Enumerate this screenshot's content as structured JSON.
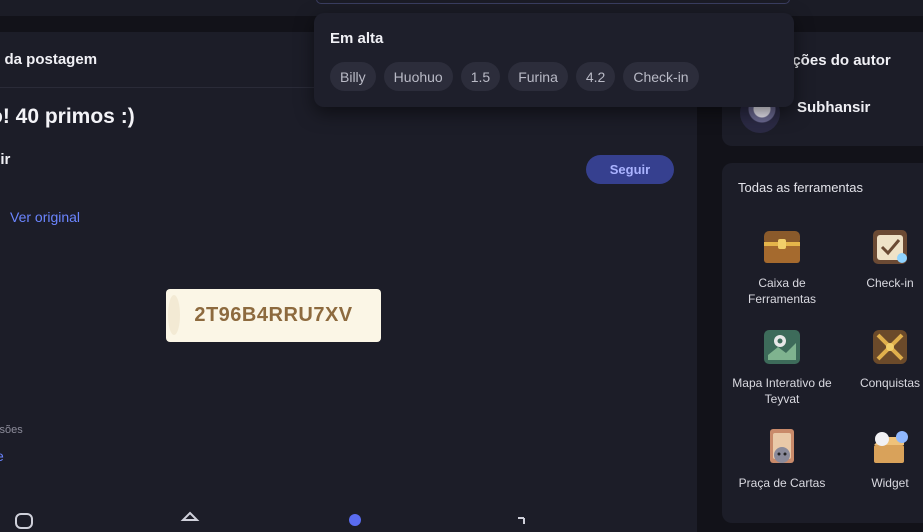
{
  "trending": {
    "title": "Em alta",
    "chips": [
      "Billy",
      "Huohuo",
      "1.5",
      "Furina",
      "4.2",
      "Check-in"
    ]
  },
  "post": {
    "header_title": "s da postagem",
    "title": "o! 40 primos :)",
    "author": "sir",
    "follow_label": "Seguir",
    "view_original": "Ver original",
    "code": "2T96B4RRU7XV",
    "views_label": "ssões",
    "link_fragment": "e"
  },
  "author_card": {
    "title": "ações do autor",
    "name": "Subhansir"
  },
  "tools": {
    "title": "Todas as ferramentas",
    "items": [
      {
        "label": "Caixa de Ferramentas",
        "icon": "treasure-chest-icon"
      },
      {
        "label": "Check-in",
        "icon": "checkin-calendar-icon"
      },
      {
        "label": "Mapa Interativo de Teyvat",
        "icon": "map-pin-icon"
      },
      {
        "label": "Conquistas",
        "icon": "achievements-swords-icon"
      },
      {
        "label": "Praça de Cartas",
        "icon": "card-cat-icon"
      },
      {
        "label": "Widget",
        "icon": "widget-box-icon"
      }
    ]
  },
  "colors": {
    "accent": "#6b85ff",
    "follow_bg": "#36408f",
    "code_bg": "#fbf6e6",
    "code_text": "#8d6a3e"
  }
}
